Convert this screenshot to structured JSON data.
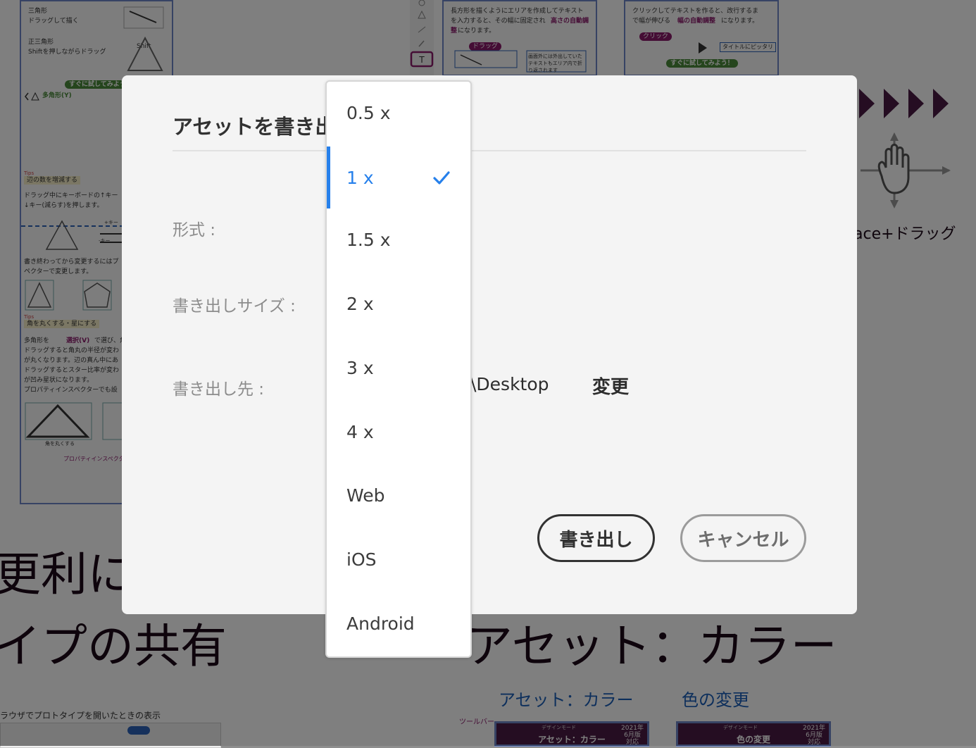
{
  "background": {
    "left_page": {
      "labels": [
        "三角形",
        "ドラッグして描く",
        "正三角形",
        "Shiftを押しながらドラッグ",
        "すぐに試してみよう",
        "多角形(Y)",
        "辺の数を増減する",
        "ドラッグ中にキーボードの↑キー",
        "↓キー(減らす)を押します。",
        "書き終わってから変更するにはプ",
        "ペクターで変更します。",
        "角を丸くする・星にする",
        "多角形を",
        "選択(V)",
        "で選び、角",
        "ドラッグすると角丸の半径が変わ",
        "が丸くなります。辺の真ん中にあ",
        "ドラッグするとスター比率が変わ",
        "が凹み星状になります。",
        "プロパティインスペクターでも設",
        "角を丸くする",
        "プロパティインスペクター",
        "Tips",
        "Tips",
        "Shift",
        "+キー",
        "-キー"
      ]
    },
    "mid_page": {
      "lines": [
        "長方形を描くようにエリアを作成してテキスト",
        "を入力すると、その幅に固定され",
        "高さの自動調",
        "整",
        "になります。",
        "ドラッグ",
        "画面外には外出していた",
        "テキストもエリア内で折",
        "り返されます"
      ]
    },
    "right_page": {
      "lines": [
        "クリックしてテキストを作ると、改行するま",
        "で幅が伸びる",
        "幅の自動調整",
        "になります。",
        "クリック",
        "タイトルにピッタリ",
        "すぐに試してみよう！"
      ]
    },
    "hand_caption": "ace+ドラッグ",
    "heading_left_1": "更利に",
    "heading_left_2": "イプの共有",
    "heading_right": "アセット：カラー",
    "link_assets_color": "アセット：カラー",
    "link_color_change": "色の変更",
    "browser_caption": "ラウザでプロトタイプを開いたときの表示",
    "toolbar_label": "ツールバー",
    "banner_1": {
      "mode": "デザインモード",
      "title": "アセット：カラー",
      "badge": "2021年 6月版 対応"
    },
    "banner_2": {
      "mode": "デザインモード",
      "title": "色の変更",
      "badge": "2021年 6月版 対応"
    }
  },
  "dialog": {
    "title": "アセットを書き出し",
    "labels": {
      "format": "形式 :",
      "export_size": "書き出しサイズ :",
      "destination": "書き出し先 :"
    },
    "destination_path_visible": "\\Desktop",
    "change_label": "変更",
    "export_button": "書き出し",
    "cancel_button": "キャンセル"
  },
  "dropdown": {
    "options": [
      "0.5 x",
      "1 x",
      "1.5 x",
      "2 x",
      "3 x",
      "4 x",
      "Web",
      "iOS",
      "Android"
    ],
    "selected": "1 x"
  },
  "colors": {
    "accent_blue": "#2680eb",
    "dialog_bg": "#f4f4f4",
    "brand_purple": "#4a1a44",
    "overlay": "rgba(0,0,0,0.5)"
  },
  "icons": {
    "check": "checkmark-icon",
    "hand": "hand-icon"
  }
}
